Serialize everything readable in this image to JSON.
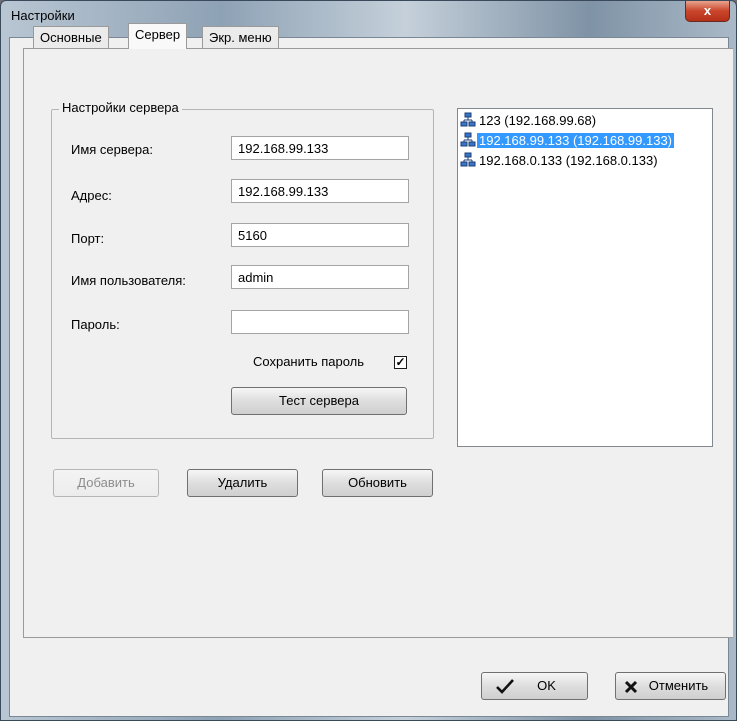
{
  "window": {
    "title": "Настройки",
    "close_label": "x"
  },
  "tabs": [
    {
      "label": "Основные",
      "active": false
    },
    {
      "label": "Сервер",
      "active": true
    },
    {
      "label": "Экр. меню",
      "active": false
    }
  ],
  "server_group": {
    "legend": "Настройки сервера",
    "name_label": "Имя сервера:",
    "name_value": "192.168.99.133",
    "address_label": "Адрес:",
    "address_value": "192.168.99.133",
    "port_label": "Порт:",
    "port_value": "5160",
    "user_label": "Имя пользователя:",
    "user_value": "admin",
    "password_label": "Пароль:",
    "password_value": "",
    "save_password_label": "Сохранить пароль",
    "save_password_checked": true,
    "test_button": "Тест сервера"
  },
  "server_list": [
    {
      "text": "123 (192.168.99.68)",
      "selected": false,
      "icon": "network-server-icon"
    },
    {
      "text": "192.168.99.133 (192.168.99.133)",
      "selected": true,
      "icon": "network-server-icon"
    },
    {
      "text": "192.168.0.133 (192.168.0.133)",
      "selected": false,
      "icon": "network-server-icon"
    }
  ],
  "actions": {
    "add": "Добавить",
    "delete": "Удалить",
    "refresh": "Обновить"
  },
  "footer": {
    "ok": "OK",
    "cancel": "Отменить"
  },
  "colors": {
    "selection": "#3399ff",
    "close_button": "#c9452a"
  }
}
